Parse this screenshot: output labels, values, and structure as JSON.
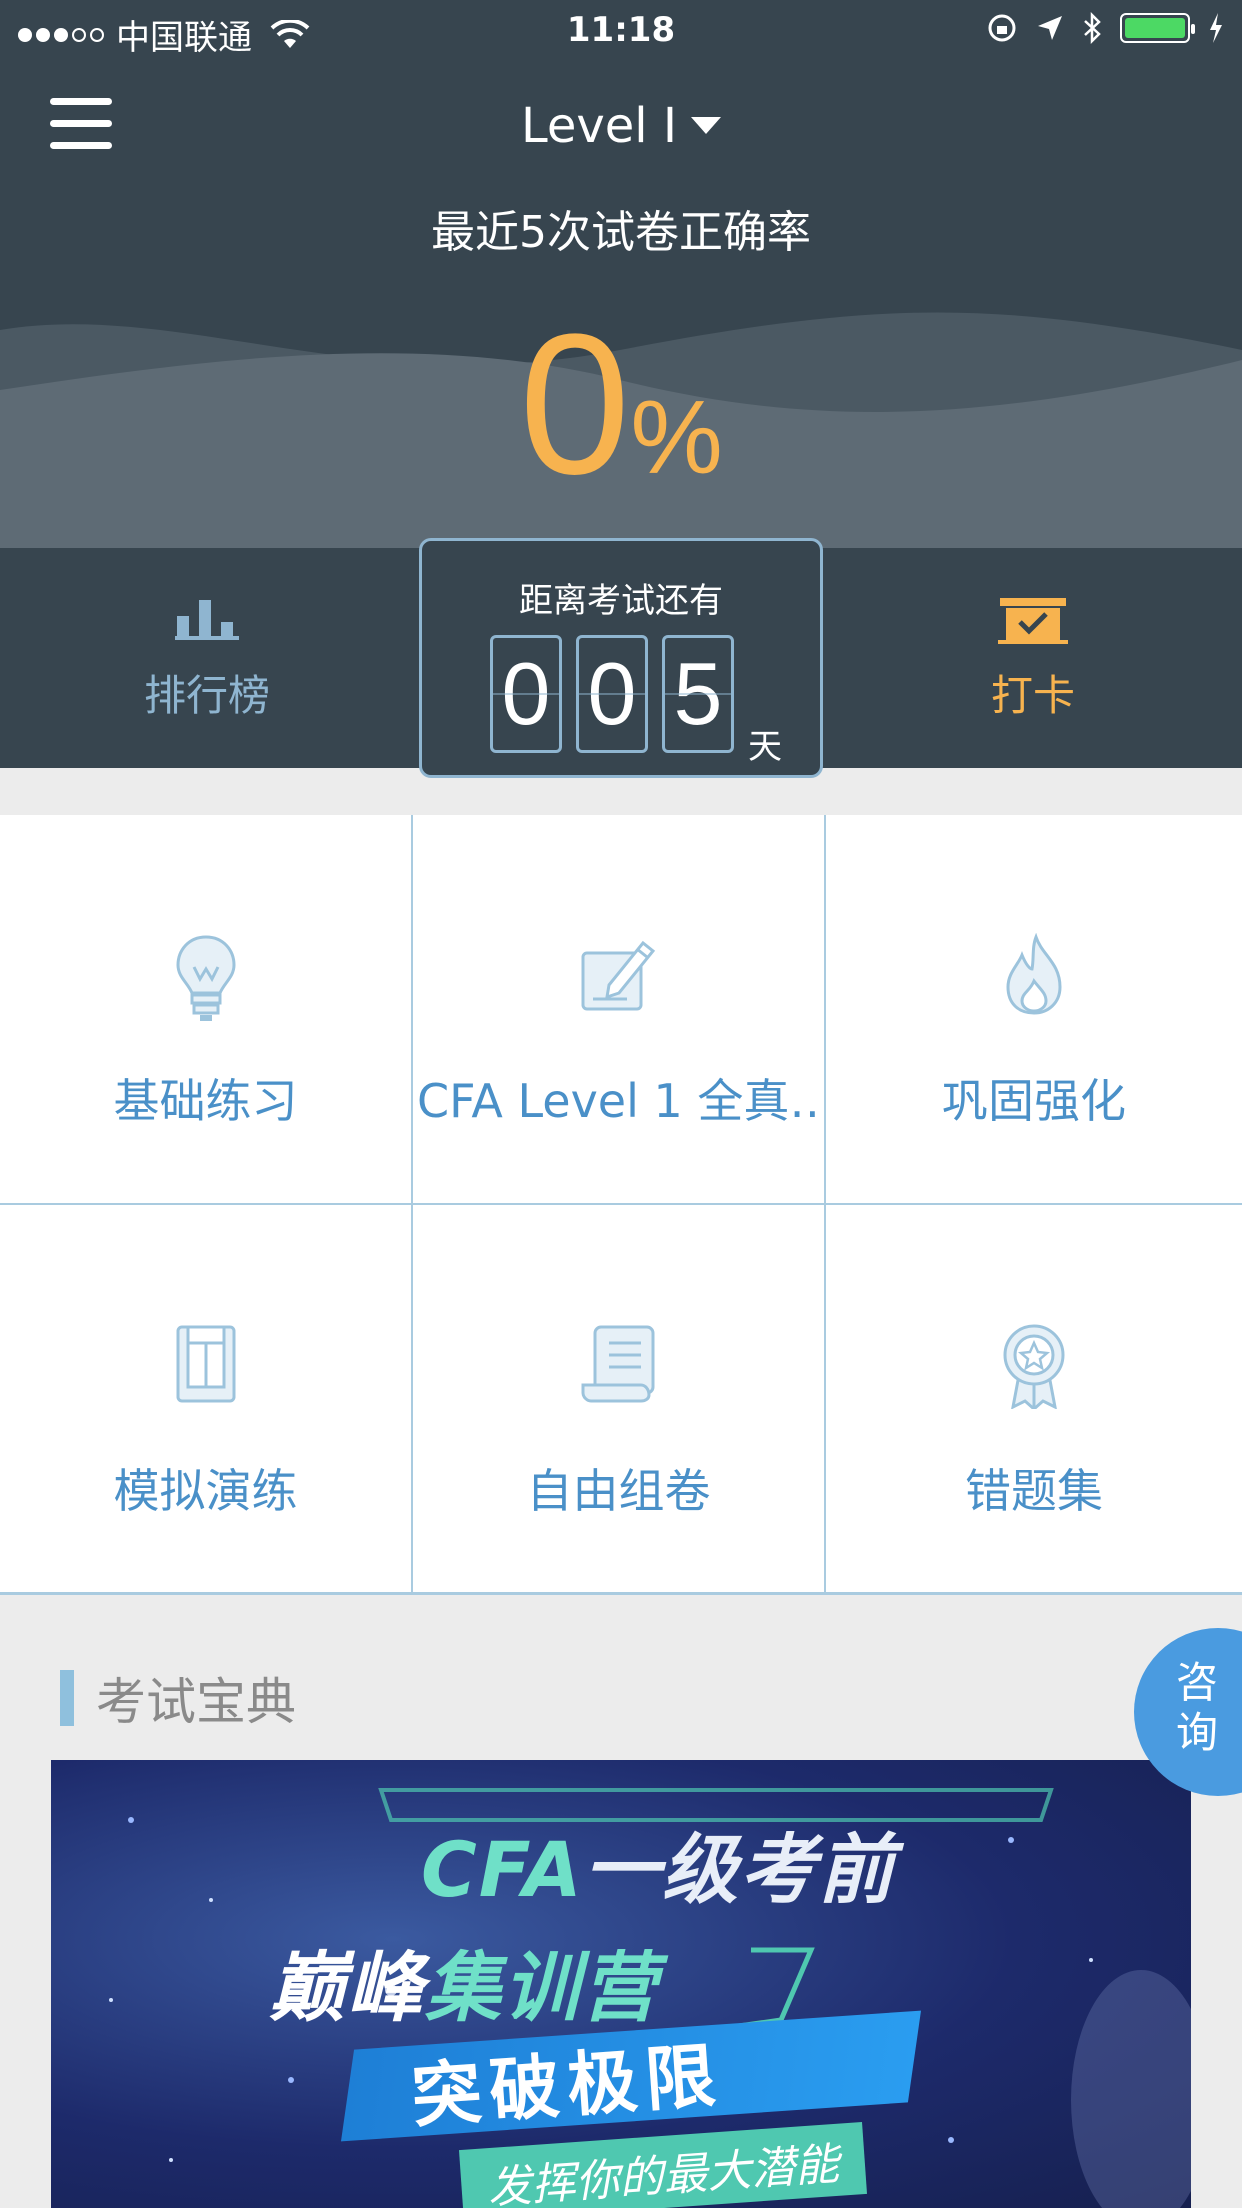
{
  "status_bar": {
    "carrier": "中国联通",
    "time": "11:18"
  },
  "header": {
    "level": "Level I",
    "subtitle": "最近5次试卷正确率",
    "accuracy_value": "0",
    "accuracy_symbol": "%"
  },
  "nav": {
    "ranking_label": "排行榜",
    "checkin_label": "打卡"
  },
  "countdown": {
    "label": "距离考试还有",
    "digits": [
      "0",
      "0",
      "5"
    ],
    "unit": "天"
  },
  "features": [
    {
      "label": "基础练习",
      "icon": "lightbulb-icon"
    },
    {
      "label": "CFA Level 1 全真…",
      "icon": "edit-icon"
    },
    {
      "label": "巩固强化",
      "icon": "flame-icon"
    },
    {
      "label": "模拟演练",
      "icon": "book-icon"
    },
    {
      "label": "自由组卷",
      "icon": "document-icon"
    },
    {
      "label": "错题集",
      "icon": "badge-icon"
    }
  ],
  "section": {
    "title": "考试宝典"
  },
  "consult": {
    "line1": "咨",
    "line2": "询"
  },
  "banner": {
    "line1_cfa": "CFA",
    "line1_rest": "一级考前",
    "line2_a": "巅峰",
    "line2_b": "集训营",
    "line3": "突破极限",
    "line4": "发挥你的最大潜能"
  },
  "colors": {
    "header_bg": "#37454f",
    "accent_orange": "#f7b34f",
    "accent_blue": "#4a90c8",
    "border_blue": "#a9cbe0"
  }
}
